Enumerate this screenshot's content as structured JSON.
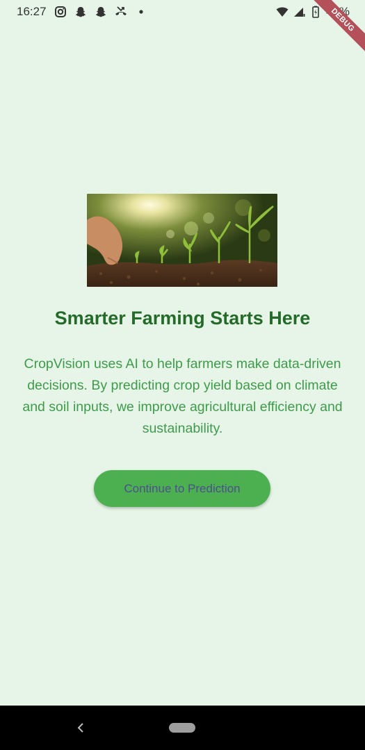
{
  "status_bar": {
    "time": "16:27",
    "battery": "45%",
    "icons": [
      "instagram-icon",
      "snapchat-icon",
      "snapchat-icon",
      "missed-call-icon",
      "dot-icon",
      "wifi-icon",
      "signal-icon",
      "battery-icon"
    ]
  },
  "debug_banner": {
    "label": "DEBUG"
  },
  "hero": {
    "image": "seedlings-growing-in-soil-with-hand-planting"
  },
  "main": {
    "title": "Smarter Farming Starts Here",
    "description": "CropVision uses AI to help farmers make data-driven decisions. By predicting crop yield based on climate and soil inputs, we improve agricultural efficiency and sustainability.",
    "cta_label": "Continue to Prediction"
  },
  "colors": {
    "background": "#e6f5e7",
    "title": "#246b2a",
    "description": "#3f9a4b",
    "button": "#4caf50",
    "button_text": "#4c4f8f"
  }
}
